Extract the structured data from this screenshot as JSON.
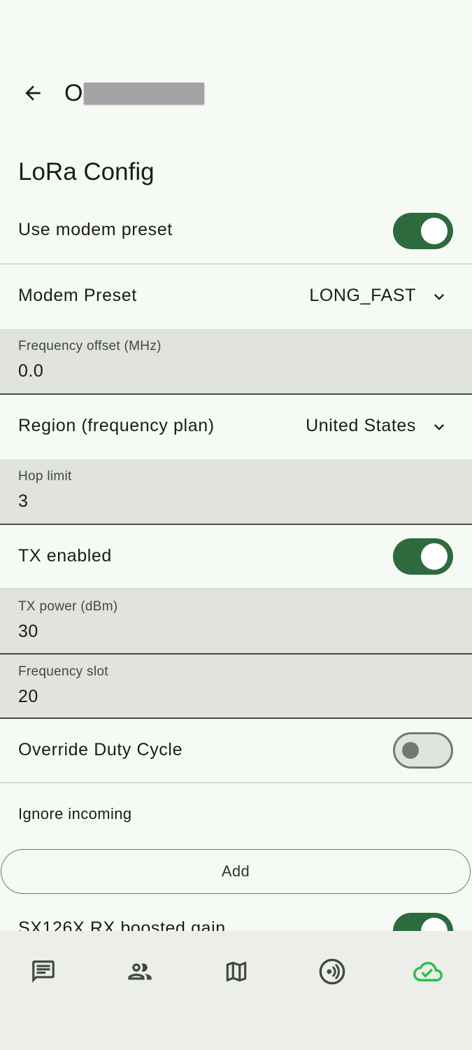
{
  "header": {
    "title_visible": "O",
    "back_icon": "arrow-back-icon"
  },
  "section_title": "LoRa Config",
  "settings": {
    "use_modem_preset": {
      "label": "Use modem preset",
      "enabled": true
    },
    "modem_preset": {
      "label": "Modem Preset",
      "value": "LONG_FAST"
    },
    "frequency_offset": {
      "label": "Frequency offset (MHz)",
      "value": "0.0"
    },
    "region": {
      "label": "Region (frequency plan)",
      "value": "United States"
    },
    "hop_limit": {
      "label": "Hop limit",
      "value": "3"
    },
    "tx_enabled": {
      "label": "TX enabled",
      "enabled": true
    },
    "tx_power": {
      "label": "TX power (dBm)",
      "value": "30"
    },
    "frequency_slot": {
      "label": "Frequency slot",
      "value": "20"
    },
    "override_duty_cycle": {
      "label": "Override Duty Cycle",
      "enabled": false
    },
    "ignore_incoming": {
      "label": "Ignore incoming",
      "add_label": "Add"
    },
    "sx126x_rx_boosted_gain": {
      "label": "SX126X RX boosted gain",
      "enabled": true
    }
  },
  "bottom_nav": {
    "items": [
      {
        "icon": "chat-icon"
      },
      {
        "icon": "people-icon"
      },
      {
        "icon": "map-icon"
      },
      {
        "icon": "radio-nearby-icon"
      },
      {
        "icon": "cloud-done-icon",
        "active": true
      }
    ],
    "active_color": "#2fbf4f",
    "inactive_color": "#42493f"
  },
  "colors": {
    "switch_on": "#2d6a3e",
    "background": "#f6faf4",
    "field_background": "#e0e3de"
  }
}
